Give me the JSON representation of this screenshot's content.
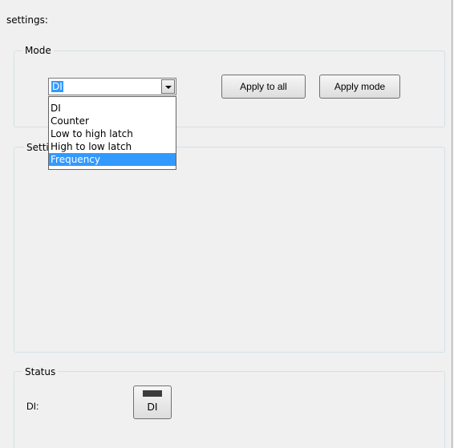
{
  "header": {
    "title": "settings:"
  },
  "mode": {
    "title": "Mode",
    "combo_value": "DI",
    "options": [
      "DI",
      "Counter",
      "Low to high latch",
      "High to low latch",
      "Frequency"
    ],
    "highlighted_option": "Frequency",
    "apply_all_label": "Apply to all",
    "apply_mode_label": "Apply mode"
  },
  "settings": {
    "title": "Setti"
  },
  "status": {
    "title": "Status",
    "di_label": "DI:",
    "di_indicator_label": "DI"
  },
  "colors": {
    "window_bg": "#f0f0f0",
    "selection": "#3399ff",
    "indicator_led": "#3c3c3c"
  }
}
